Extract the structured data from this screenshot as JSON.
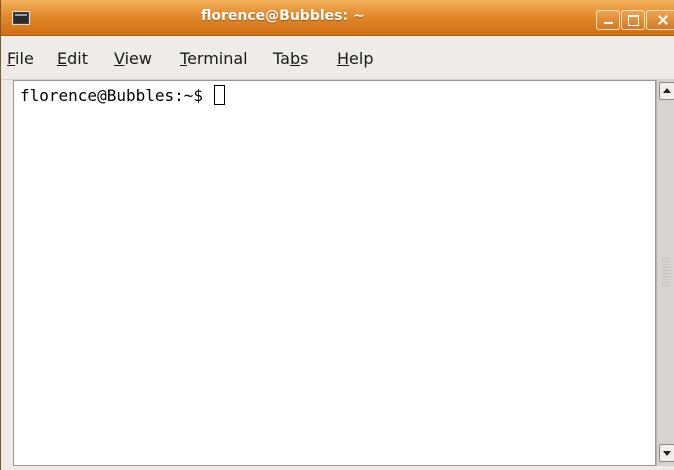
{
  "window": {
    "title": "florence@Bubbles: ~",
    "icon": "terminal-icon",
    "controls": [
      "minimize-icon",
      "maximize-icon",
      "close-icon"
    ]
  },
  "menu": {
    "items": [
      {
        "label_pre": "",
        "mnemonic": "F",
        "label_post": "ile"
      },
      {
        "label_pre": "",
        "mnemonic": "E",
        "label_post": "dit"
      },
      {
        "label_pre": "",
        "mnemonic": "V",
        "label_post": "iew"
      },
      {
        "label_pre": "",
        "mnemonic": "T",
        "label_post": "erminal"
      },
      {
        "label_pre": "Ta",
        "mnemonic": "b",
        "label_post": "s"
      },
      {
        "label_pre": "",
        "mnemonic": "H",
        "label_post": "elp"
      }
    ]
  },
  "terminal": {
    "prompt": "florence@Bubbles:~$ "
  },
  "colors": {
    "titlebar_accent": "#e28a2d",
    "background": "#efebe7",
    "terminal_bg": "#ffffff",
    "text": "#000000"
  }
}
